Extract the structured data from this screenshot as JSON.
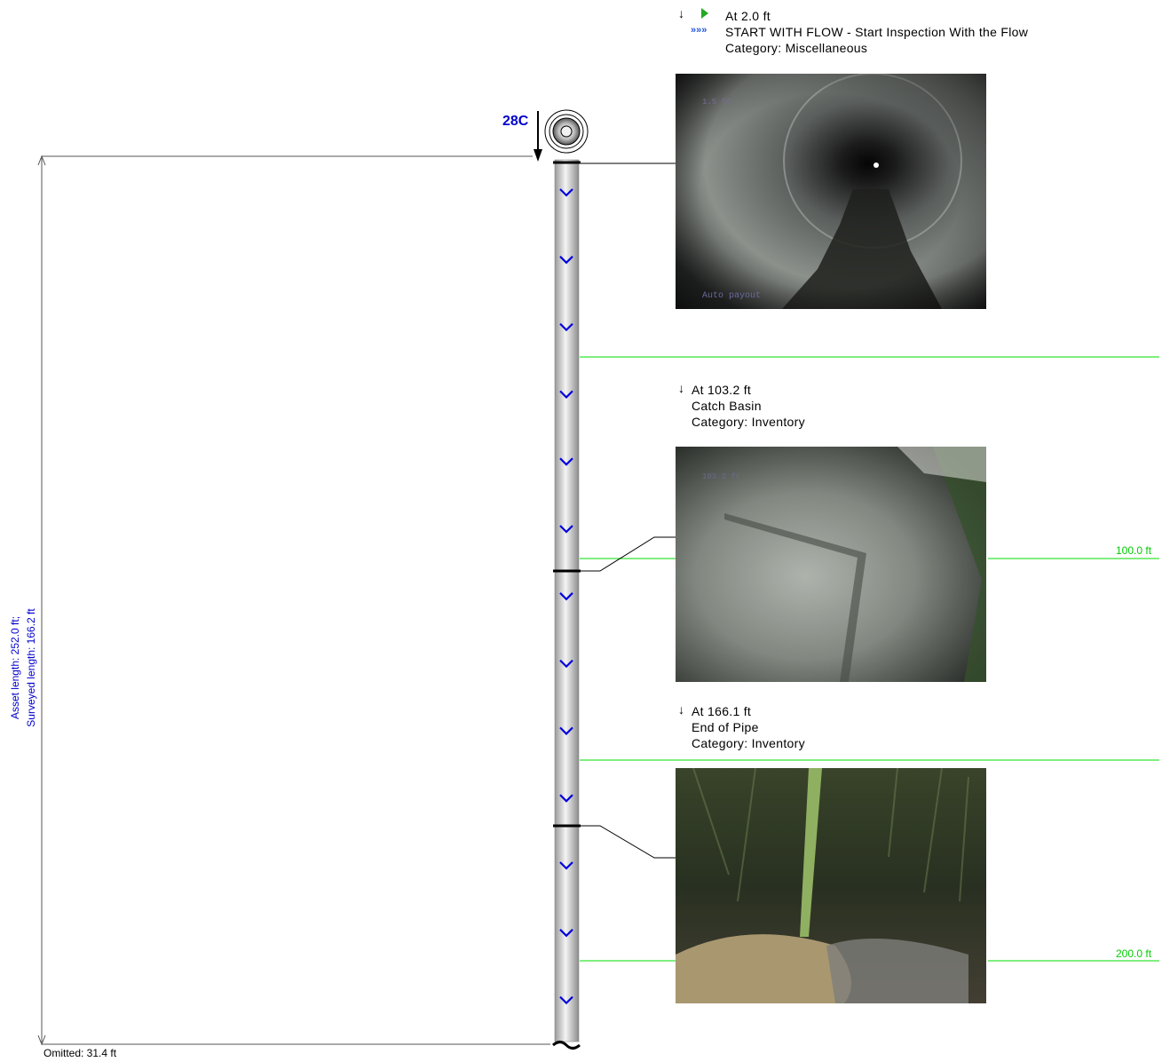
{
  "manhole": {
    "label": "28C"
  },
  "dimension": {
    "asset_length": "Asset length: 252.0 ft;",
    "surveyed_length": "Surveyed length: 166.2 ft"
  },
  "omitted": "Omitted: 31.4 ft",
  "rulers": [
    {
      "label": ""
    },
    {
      "label": "100.0 ft"
    },
    {
      "label": ""
    },
    {
      "label": "200.0 ft"
    }
  ],
  "observations": [
    {
      "position": "At 2.0 ft",
      "title": "START WITH FLOW - Start Inspection With the Flow",
      "category": "Category: Miscellaneous",
      "photo_overlay_top": "1.5 ft",
      "photo_overlay_bottom": "Auto payout",
      "icon": "start-with-flow-icon"
    },
    {
      "position": "At 103.2 ft",
      "title": "Catch Basin",
      "category": "Category: Inventory",
      "photo_overlay_top": "103.2 ft",
      "icon": "down-arrow-icon"
    },
    {
      "position": "At 166.1 ft",
      "title": "End of Pipe",
      "category": "Category: Inventory",
      "icon": "down-arrow-icon"
    }
  ],
  "colors": {
    "ruler": "#00dd00",
    "flow_arrow": "#0000dd",
    "dimension_text": "#0000cc"
  }
}
